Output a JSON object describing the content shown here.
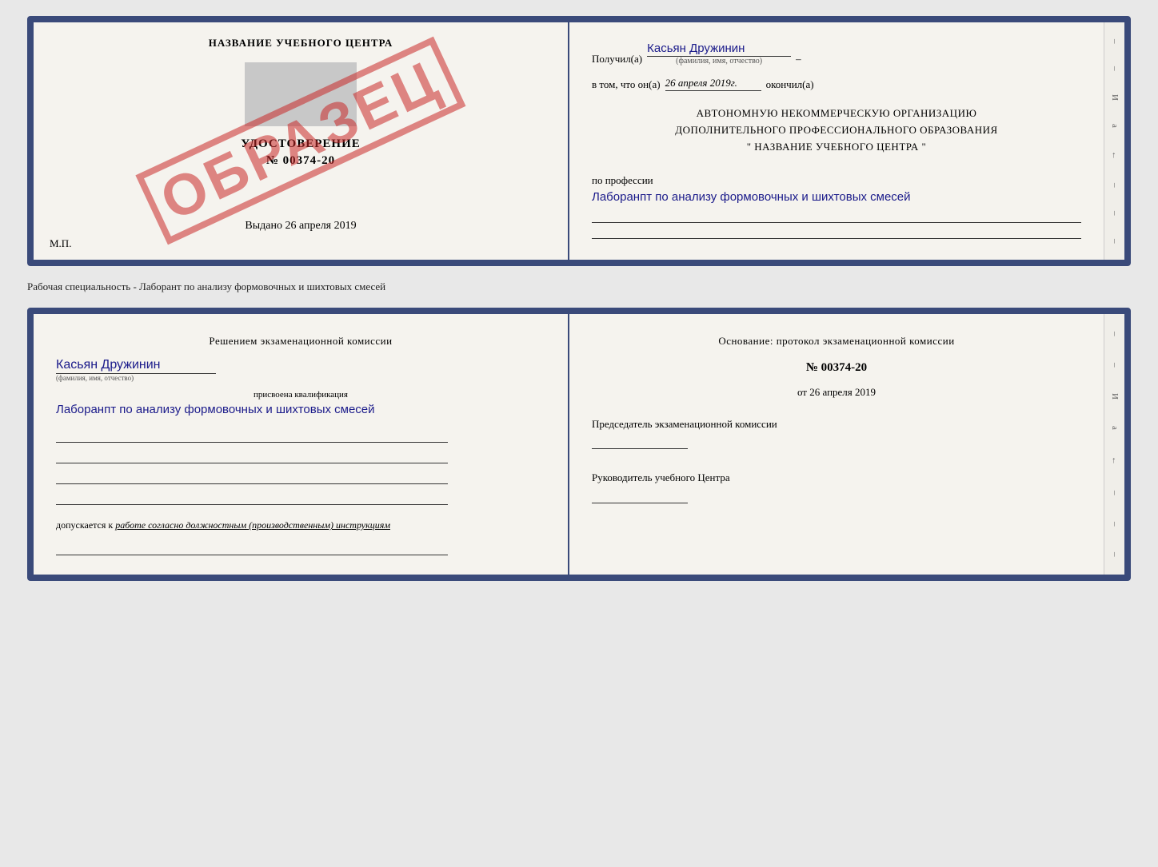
{
  "topDoc": {
    "left": {
      "title": "НАЗВАНИЕ УЧЕБНОГО ЦЕНТРА",
      "udostLabel": "УДОСТОВЕРЕНИЕ",
      "numberLabel": "№ 00374-20",
      "vydanoLabel": "Выдано",
      "vydanoDate": "26 апреля 2019",
      "mpLabel": "М.П.",
      "obrazec": "ОБРАЗЕЦ"
    },
    "right": {
      "poluchilLabel": "Получил(а)",
      "poluchilName": "Касьян Дружинин",
      "fioSublabel": "(фамилия, имя, отчество)",
      "vtomLabel": "в том, что он(а)",
      "vtomDate": "26 апреля 2019г.",
      "okonchilLabel": "окончил(а)",
      "orgLine1": "АВТОНОМНУЮ НЕКОММЕРЧЕСКУЮ ОРГАНИЗАЦИЮ",
      "orgLine2": "ДОПОЛНИТЕЛЬНОГО ПРОФЕССИОНАЛЬНОГО ОБРАЗОВАНИЯ",
      "orgLine3": "\"  НАЗВАНИЕ УЧЕБНОГО ЦЕНТРА  \"",
      "poProfilessii": "по профессии",
      "professionValue": "Лаборанпт по анализу формовочных и шихтовых смесей"
    }
  },
  "middleLabel": "Рабочая специальность - Лаборант по анализу формовочных и шихтовых смесей",
  "bottomDoc": {
    "left": {
      "commissionHeader": "Решением  экзаменационной  комиссии",
      "nameValue": "Касьян Дружинин",
      "nameSublabel": "(фамилия, имя, отчество)",
      "qualLabel": "присвоена квалификация",
      "qualValue": "Лаборанпт по анализу формовочных и шихтовых смесей",
      "dopuskaetsyaLabel": "допускается к",
      "dopuskaetsyaValue": "работе согласно должностным (производственным) инструкциям"
    },
    "right": {
      "osnovanieLabel": "Основание:  протокол  экзаменационной  комиссии",
      "protocolNumber": "№  00374-20",
      "otLabel": "от",
      "protocolDate": "26 апреля 2019",
      "predsedatelLabel": "Председатель экзаменационной комиссии",
      "rukovoditelLabel": "Руководитель учебного Центра"
    }
  },
  "spineChars": [
    "–",
    "–",
    "И",
    "а",
    "←",
    "–",
    "–",
    "–"
  ]
}
